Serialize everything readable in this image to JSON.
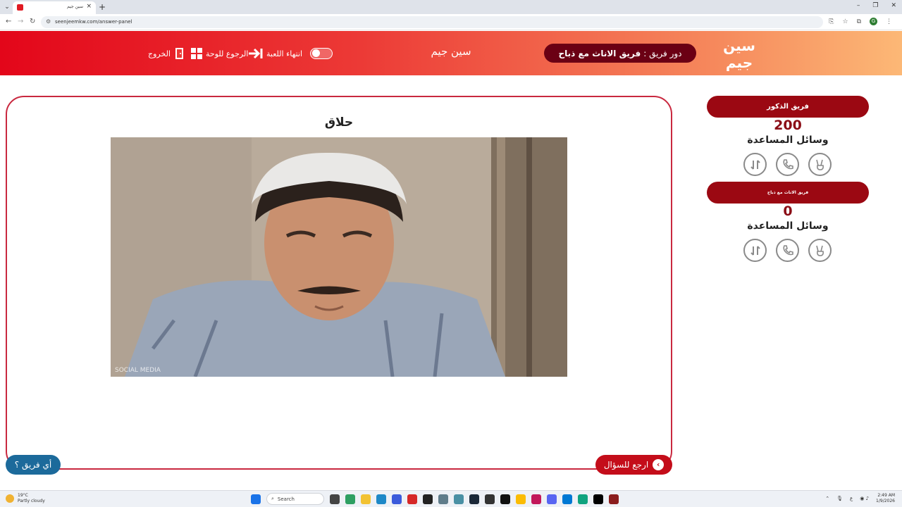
{
  "browser": {
    "tab_title": "سين جيم",
    "url": "seenjeemkw.com/answer-panel"
  },
  "header": {
    "exit_label": "الخروج",
    "back_to_board_label": "الرجوع للوحة",
    "end_game_label": "انتهاء اللعبة",
    "site_name": "سين جيم",
    "turn_prefix": "دور فريق :",
    "turn_team": "فريق الاناث مع ذباح",
    "logo_text": "سين جيم"
  },
  "answer": {
    "title": "حلاق",
    "image_watermark": "SOCIAL MEDIA"
  },
  "buttons": {
    "back_to_question": "ارجع للسؤال",
    "which_team": "أي فريق ؟"
  },
  "teams": [
    {
      "name": "فريق الذكور",
      "score": "200",
      "aids_label": "وسائل المساعدة"
    },
    {
      "name": "فريق الاناث مع ذباح",
      "score": "0",
      "aids_label": "وسائل المساعدة"
    }
  ],
  "taskbar": {
    "weather_temp": "19°C",
    "weather_desc": "Partly cloudy",
    "search_placeholder": "Search",
    "time": "2:49 AM",
    "date": "1/9/2026"
  },
  "colors": {
    "header_start": "#e3061a",
    "header_end": "#fcb876",
    "team_pill": "#9b0812",
    "panel_border": "#c9283f",
    "which_team_button": "#1c6a9b"
  }
}
